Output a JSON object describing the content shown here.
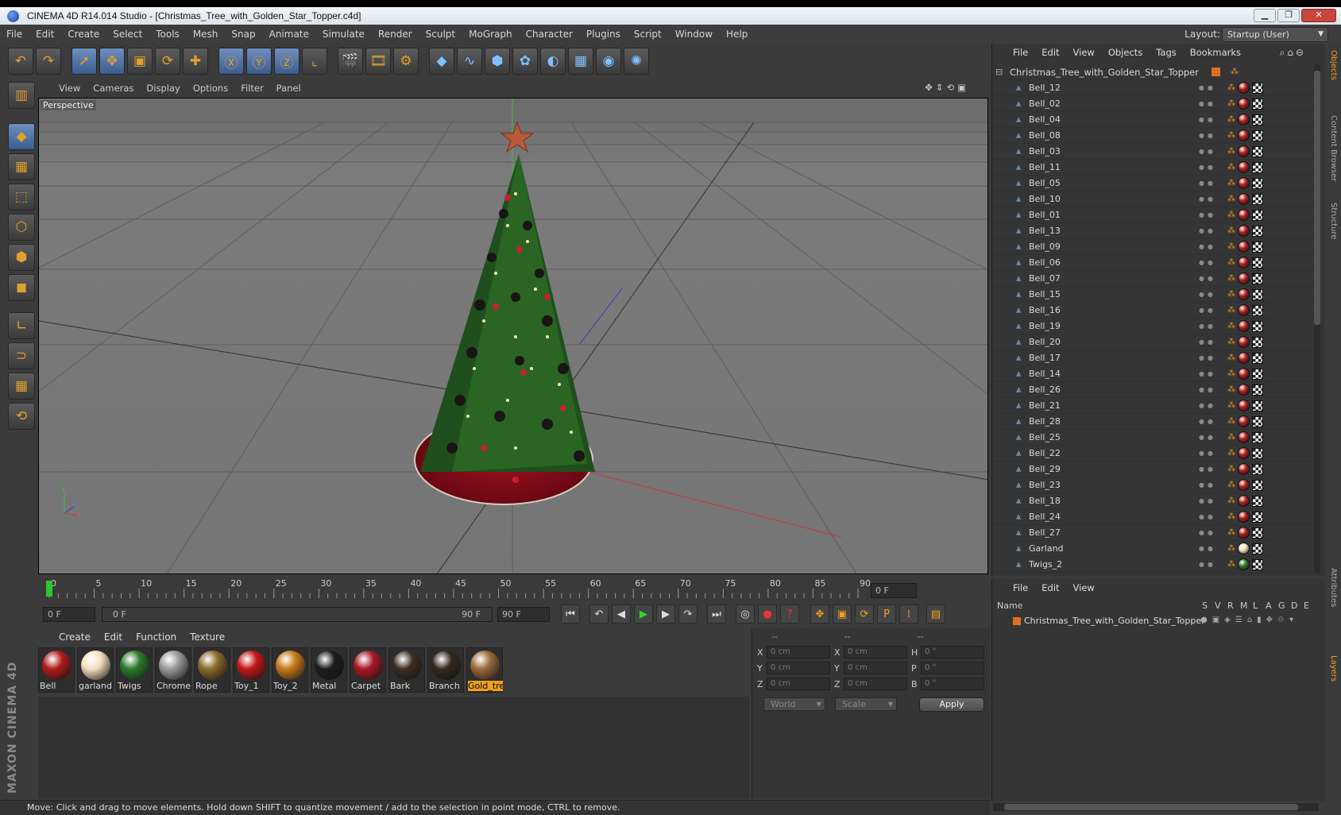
{
  "window": {
    "title": "CINEMA 4D R14.014 Studio - [Christmas_Tree_with_Golden_Star_Topper.c4d]"
  },
  "menu": [
    "File",
    "Edit",
    "Create",
    "Select",
    "Tools",
    "Mesh",
    "Snap",
    "Animate",
    "Simulate",
    "Render",
    "Sculpt",
    "MoGraph",
    "Character",
    "Plugins",
    "Script",
    "Window",
    "Help"
  ],
  "layout": {
    "label": "Layout:",
    "value": "Startup (User)"
  },
  "toolbar_icons": [
    "undo-icon",
    "redo-icon",
    "move-select-icon",
    "move-icon",
    "scale-icon",
    "rotate-icon",
    "add-icon",
    "x-axis-icon",
    "y-axis-icon",
    "z-axis-icon",
    "coord-system-icon",
    "render-view-icon",
    "render-picture-viewer-icon",
    "render-settings-icon",
    "cube-icon",
    "spline-icon",
    "nurbs-icon",
    "array-icon",
    "deformer-icon",
    "floor-icon",
    "camera-icon",
    "light-icon"
  ],
  "viewport": {
    "menu": [
      "View",
      "Cameras",
      "Display",
      "Options",
      "Filter",
      "Panel"
    ],
    "label": "Perspective"
  },
  "timeline": {
    "ticks": [
      "0",
      "5",
      "10",
      "15",
      "20",
      "25",
      "30",
      "35",
      "40",
      "45",
      "50",
      "55",
      "60",
      "65",
      "70",
      "75",
      "80",
      "85",
      "90"
    ],
    "current": "0 F",
    "start": "0 F",
    "range_start": "0 F",
    "range_end": "90 F",
    "end": "90 F"
  },
  "materials": {
    "menu": [
      "Create",
      "Edit",
      "Function",
      "Texture"
    ],
    "items": [
      {
        "name": "Bell",
        "color": "#b01c1c"
      },
      {
        "name": "garland",
        "color": "#f5e0c0"
      },
      {
        "name": "Twigs",
        "color": "#2c7a2c"
      },
      {
        "name": "Chrome",
        "color": "#9a9a9a"
      },
      {
        "name": "Rope",
        "color": "#8a6a2a"
      },
      {
        "name": "Toy_1",
        "color": "#c01818"
      },
      {
        "name": "Toy_2",
        "color": "#c87a18"
      },
      {
        "name": "Metal",
        "color": "#1e1e1e"
      },
      {
        "name": "Carpet",
        "color": "#a81828"
      },
      {
        "name": "Bark",
        "color": "#3c2e20"
      },
      {
        "name": "Branch",
        "color": "#34281c"
      },
      {
        "name": "Gold_tre",
        "color": "#9a6a3a"
      }
    ]
  },
  "attributes": {
    "headers": [
      "--",
      "--",
      "--"
    ],
    "rows": [
      [
        {
          "l": "X",
          "v": "0 cm"
        },
        {
          "l": "X",
          "v": "0 cm"
        },
        {
          "l": "H",
          "v": "0 °"
        }
      ],
      [
        {
          "l": "Y",
          "v": "0 cm"
        },
        {
          "l": "Y",
          "v": "0 cm"
        },
        {
          "l": "P",
          "v": "0 °"
        }
      ],
      [
        {
          "l": "Z",
          "v": "0 cm"
        },
        {
          "l": "Z",
          "v": "0 cm"
        },
        {
          "l": "B",
          "v": "0 °"
        }
      ]
    ],
    "coord_mode": "World",
    "transform_mode": "Scale",
    "apply": "Apply"
  },
  "objects": {
    "menu": [
      "File",
      "Edit",
      "View",
      "Objects",
      "Tags",
      "Bookmarks"
    ],
    "root": "Christmas_Tree_with_Golden_Star_Topper",
    "items": [
      {
        "name": "Bell_12",
        "mat": "#b01c1c"
      },
      {
        "name": "Bell_02",
        "mat": "#b01c1c"
      },
      {
        "name": "Bell_04",
        "mat": "#b01c1c"
      },
      {
        "name": "Bell_08",
        "mat": "#b01c1c"
      },
      {
        "name": "Bell_03",
        "mat": "#b01c1c"
      },
      {
        "name": "Bell_11",
        "mat": "#b01c1c"
      },
      {
        "name": "Bell_05",
        "mat": "#b01c1c"
      },
      {
        "name": "Bell_10",
        "mat": "#b01c1c"
      },
      {
        "name": "Bell_01",
        "mat": "#b01c1c"
      },
      {
        "name": "Bell_13",
        "mat": "#b01c1c"
      },
      {
        "name": "Bell_09",
        "mat": "#b01c1c"
      },
      {
        "name": "Bell_06",
        "mat": "#b01c1c"
      },
      {
        "name": "Bell_07",
        "mat": "#b01c1c"
      },
      {
        "name": "Bell_15",
        "mat": "#b01c1c"
      },
      {
        "name": "Bell_16",
        "mat": "#b01c1c"
      },
      {
        "name": "Bell_19",
        "mat": "#b01c1c"
      },
      {
        "name": "Bell_20",
        "mat": "#b01c1c"
      },
      {
        "name": "Bell_17",
        "mat": "#b01c1c"
      },
      {
        "name": "Bell_14",
        "mat": "#b01c1c"
      },
      {
        "name": "Bell_26",
        "mat": "#b01c1c"
      },
      {
        "name": "Bell_21",
        "mat": "#b01c1c"
      },
      {
        "name": "Bell_28",
        "mat": "#b01c1c"
      },
      {
        "name": "Bell_25",
        "mat": "#b01c1c"
      },
      {
        "name": "Bell_22",
        "mat": "#b01c1c"
      },
      {
        "name": "Bell_29",
        "mat": "#b01c1c"
      },
      {
        "name": "Bell_23",
        "mat": "#b01c1c"
      },
      {
        "name": "Bell_18",
        "mat": "#b01c1c"
      },
      {
        "name": "Bell_24",
        "mat": "#b01c1c"
      },
      {
        "name": "Bell_27",
        "mat": "#b01c1c"
      },
      {
        "name": "Garland",
        "mat": "#f5e0c0"
      },
      {
        "name": "Twigs_2",
        "mat": "#2c7a2c"
      }
    ]
  },
  "side_tabs": [
    "Objects",
    "Content Browser",
    "Structure",
    "Attributes",
    "Layers"
  ],
  "layers": {
    "menu": [
      "File",
      "Edit",
      "View"
    ],
    "header": "Name",
    "columns": [
      "S",
      "V",
      "R",
      "M",
      "L",
      "A",
      "G",
      "D",
      "E"
    ],
    "row": "Christmas_Tree_with_Golden_Star_Topper"
  },
  "status": "Move: Click and drag to move elements. Hold down SHIFT to quantize movement / add to the selection in point mode, CTRL to remove.",
  "brand": "MAXON CINEMA 4D"
}
